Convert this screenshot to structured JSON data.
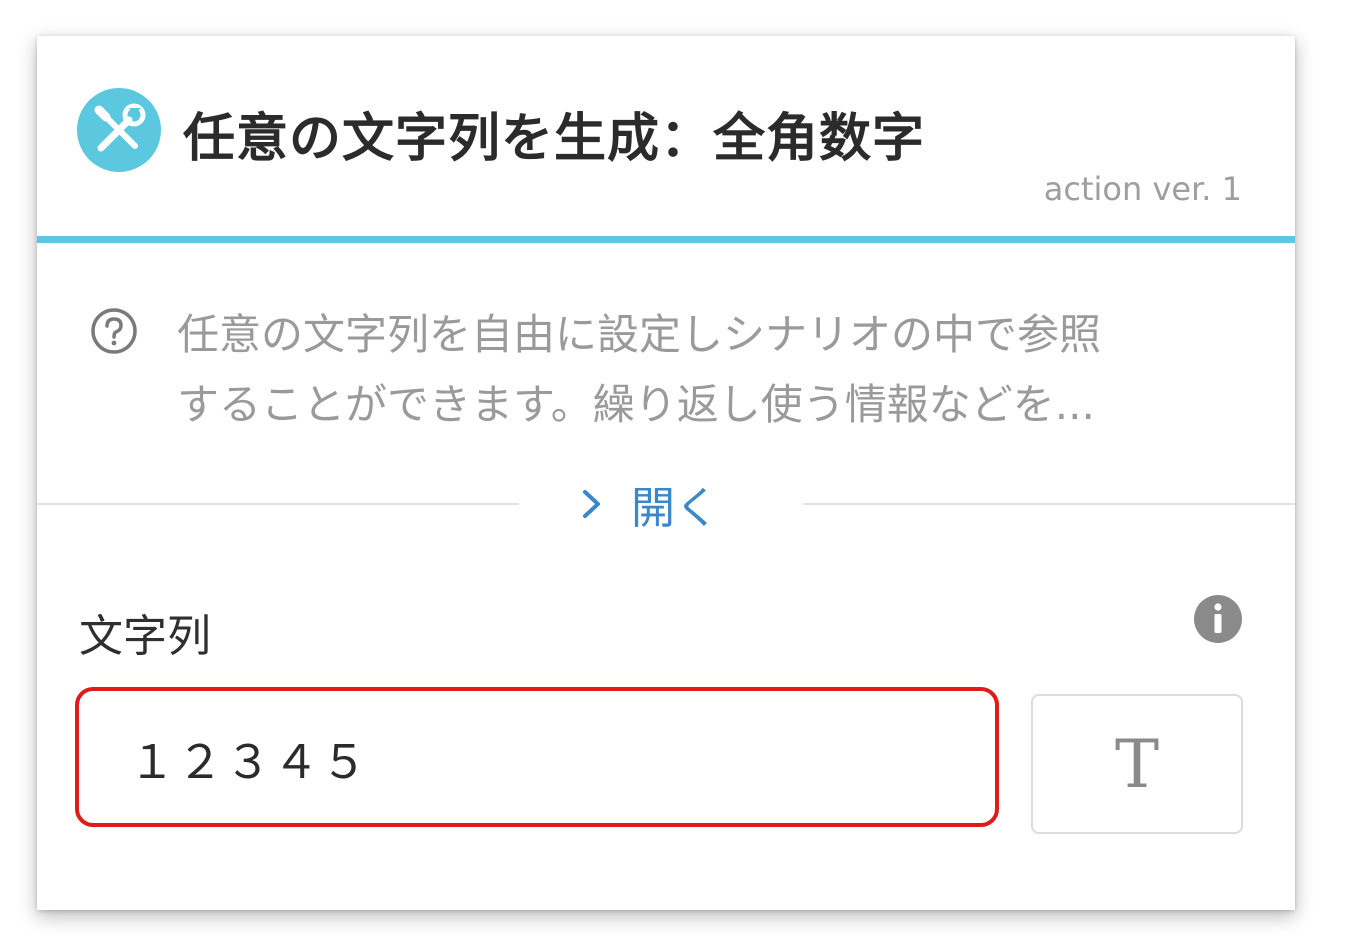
{
  "header": {
    "icon": "wrench-screwdriver-icon",
    "title": "任意の文字列を生成：全角数字",
    "version": "action ver. 1"
  },
  "description": {
    "icon": "question-circle-icon",
    "lines": [
      "任意の文字列を自由に設定しシナリオの中で参照",
      "することができます。繰り返し使う情報などを..."
    ],
    "expand_label": "開く",
    "expand_icon": "chevron-right-icon"
  },
  "field": {
    "label": "文字列",
    "info_icon": "info-circle-icon",
    "value": "１２３４５",
    "type_button_label": "T"
  },
  "colors": {
    "accent": "#5bc8e0",
    "link": "#3a87c9",
    "highlight_border": "#e01b1b"
  }
}
